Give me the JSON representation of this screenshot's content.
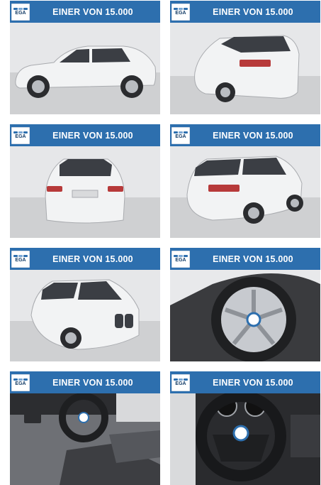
{
  "banner": {
    "logo_text": "EGA",
    "title": "EINER VON 15.000"
  },
  "tiles": [
    {
      "photo": "car-side-view"
    },
    {
      "photo": "car-rear-three-quarter-view"
    },
    {
      "photo": "car-rear-view"
    },
    {
      "photo": "car-rear-right-view"
    },
    {
      "photo": "car-front-three-quarter-view"
    },
    {
      "photo": "wheel-rim-closeup"
    },
    {
      "photo": "interior-dashboard-view"
    },
    {
      "photo": "steering-wheel-closeup"
    }
  ],
  "colors": {
    "banner": "#2d6fae",
    "banner_text": "#ffffff",
    "car_body": "#f2f3f4",
    "studio_wall": "#e6e7e9",
    "floor": "#cfd0d2"
  }
}
